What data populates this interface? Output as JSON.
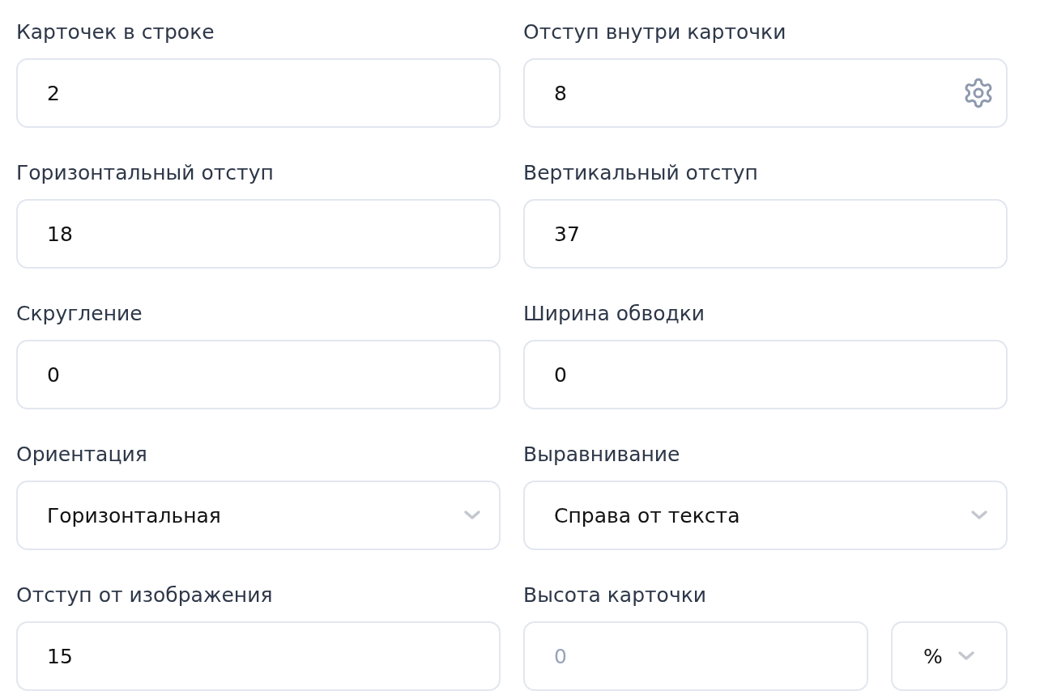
{
  "fields": [
    {
      "label": "Карточек в строке",
      "kind": "input",
      "value": "2"
    },
    {
      "label": "Отступ внутри карточки",
      "kind": "input-settings",
      "value": "8"
    },
    {
      "label": "Горизонтальный отступ",
      "kind": "input",
      "value": "18"
    },
    {
      "label": "Вертикальный отступ",
      "kind": "input",
      "value": "37"
    },
    {
      "label": "Скругление",
      "kind": "input",
      "value": "0"
    },
    {
      "label": "Ширина обводки",
      "kind": "input",
      "value": "0"
    },
    {
      "label": "Ориентация",
      "kind": "select",
      "value": "Горизонтальная"
    },
    {
      "label": "Выравнивание",
      "kind": "select",
      "value": "Справа от текста"
    },
    {
      "label": "Отступ от изображения",
      "kind": "input",
      "value": "15"
    },
    {
      "label": "Высота карточки",
      "kind": "input-unit",
      "placeholder": "0",
      "unit": "%"
    }
  ]
}
